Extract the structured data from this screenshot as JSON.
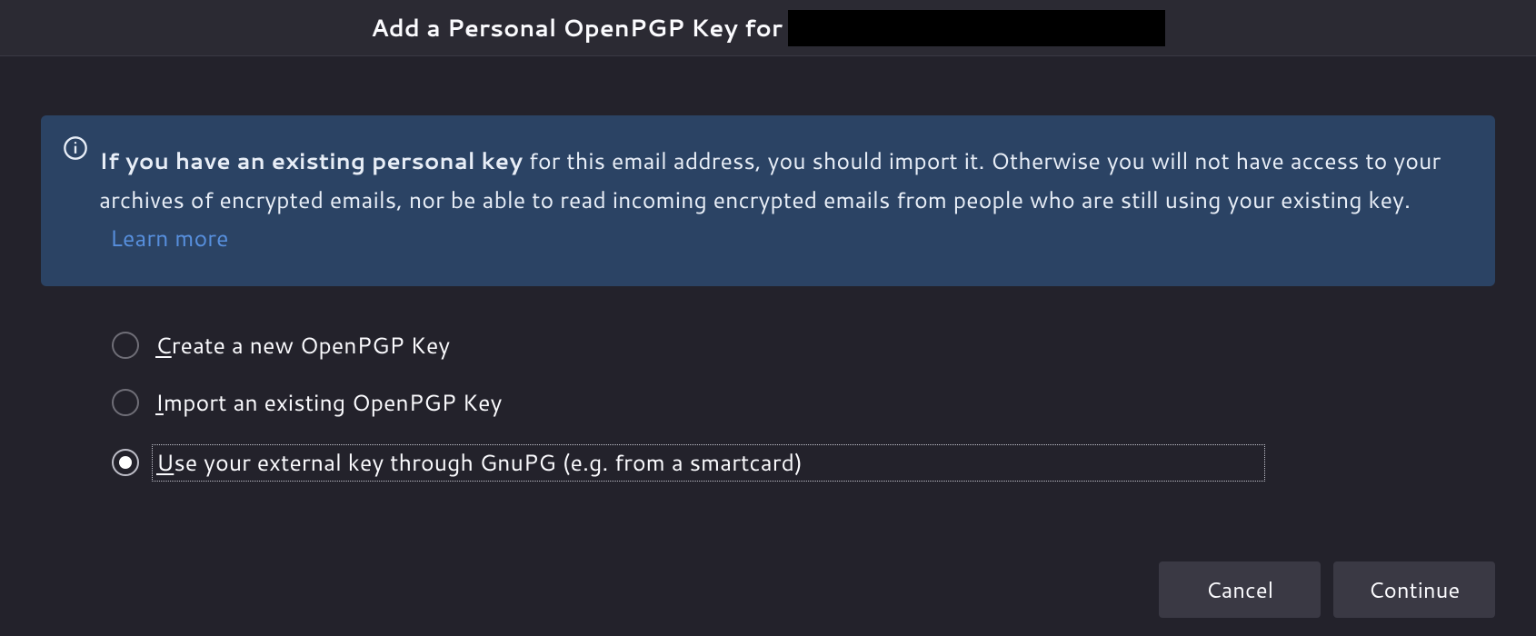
{
  "title": {
    "prefix": "Add a Personal OpenPGP Key for "
  },
  "info": {
    "bold": "If you have an existing personal key",
    "rest": " for this email address, you should import it. Otherwise you will not have access to your archives of encrypted emails, nor be able to read incoming encrypted emails from people who are still using your existing key.",
    "learn_more": "Learn more"
  },
  "radios": {
    "create": {
      "mnemonic": "C",
      "text": "reate a new OpenPGP Key",
      "selected": false
    },
    "import": {
      "mnemonic": "I",
      "text": "mport an existing OpenPGP Key",
      "selected": false
    },
    "external": {
      "mnemonic": "U",
      "text": "se your external key through GnuPG (e.g. from a smartcard)",
      "selected": true
    }
  },
  "buttons": {
    "cancel": "Cancel",
    "continue": "Continue"
  }
}
